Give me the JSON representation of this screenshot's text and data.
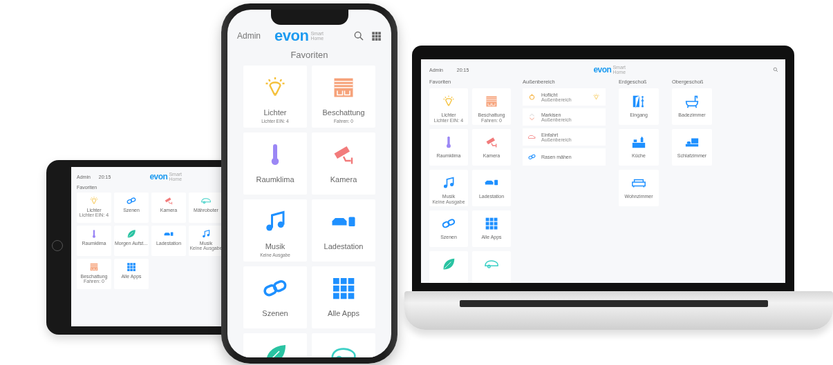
{
  "tablet": {
    "user": "Admin",
    "time": "20:15",
    "logo": {
      "brand": "evon",
      "tagline": "Smart Home"
    },
    "title": "Favoriten",
    "tiles": [
      {
        "label": "Lichter",
        "sub": "Lichter EIN: 4",
        "kind": "bulb"
      },
      {
        "label": "Szenen",
        "kind": "link"
      },
      {
        "label": "Kamera",
        "kind": "camera"
      },
      {
        "label": "Mähroboter",
        "kind": "mower"
      },
      {
        "label": "Raumklima",
        "kind": "thermo"
      },
      {
        "label": "Morgen Aufst…",
        "kind": "leaf"
      },
      {
        "label": "Ladestation",
        "kind": "car"
      },
      {
        "label": "Musik",
        "sub": "Keine Ausgabe",
        "kind": "music"
      },
      {
        "label": "Beschattung",
        "sub": "Fahren: 0",
        "kind": "shutter"
      },
      {
        "label": "Alle Apps",
        "kind": "grid"
      }
    ]
  },
  "phone": {
    "user": "Admin",
    "logo": {
      "brand": "evon",
      "tagline": "Smart Home"
    },
    "title": "Favoriten",
    "tiles": [
      {
        "label": "Lichter",
        "sub": "Lichter EIN: 4",
        "kind": "bulb"
      },
      {
        "label": "Beschattung",
        "sub": "Fahren: 0",
        "kind": "shutter"
      },
      {
        "label": "Raumklima",
        "kind": "thermo"
      },
      {
        "label": "Kamera",
        "kind": "camera"
      },
      {
        "label": "Musik",
        "sub": "Keine Ausgabe",
        "kind": "music"
      },
      {
        "label": "Ladestation",
        "kind": "car"
      },
      {
        "label": "Szenen",
        "kind": "link"
      },
      {
        "label": "Alle Apps",
        "kind": "grid"
      },
      {
        "kind": "leaf"
      },
      {
        "kind": "mower"
      }
    ]
  },
  "laptop": {
    "user": "Admin",
    "time": "20:15",
    "logo": {
      "brand": "evon",
      "tagline": "Smart Home"
    },
    "favorites": {
      "title": "Favoriten",
      "tiles": [
        {
          "label": "Lichter",
          "sub": "Lichter EIN: 4",
          "kind": "bulb"
        },
        {
          "label": "Beschattung",
          "sub": "Fahren: 0",
          "kind": "shutter"
        },
        {
          "label": "Raumklima",
          "kind": "thermo"
        },
        {
          "label": "Kamera",
          "kind": "camera"
        },
        {
          "label": "Musik",
          "sub": "Keine Ausgabe",
          "kind": "music"
        },
        {
          "label": "Ladestation",
          "kind": "car"
        },
        {
          "label": "Szenen",
          "kind": "link"
        },
        {
          "label": "Alle Apps",
          "kind": "grid"
        },
        {
          "kind": "leaf"
        },
        {
          "kind": "mower"
        }
      ]
    },
    "outdoor": {
      "title": "Außenbereich",
      "items": [
        {
          "label": "Hoflicht",
          "sub": "Außenbereich",
          "kind": "sun",
          "lamp_switch": true
        },
        {
          "label": "Markisen",
          "sub": "Außenbereich",
          "kind": "awning"
        },
        {
          "label": "Einfahrt",
          "sub": "Außenbereich",
          "kind": "redcar"
        },
        {
          "label": "Rasen mähen",
          "kind": "link"
        }
      ]
    },
    "rooms": [
      {
        "title": "Erdgeschoß",
        "tiles": [
          {
            "label": "Eingang",
            "kind": "door"
          },
          {
            "label": "Küche",
            "kind": "kitchen"
          },
          {
            "label": "Wohnzimmer",
            "kind": "sofa"
          }
        ]
      },
      {
        "title": "Obergeschoß",
        "tiles": [
          {
            "label": "Badezimmer",
            "kind": "bath"
          },
          {
            "label": "Schlafzimmer",
            "kind": "bed"
          }
        ]
      }
    ]
  }
}
